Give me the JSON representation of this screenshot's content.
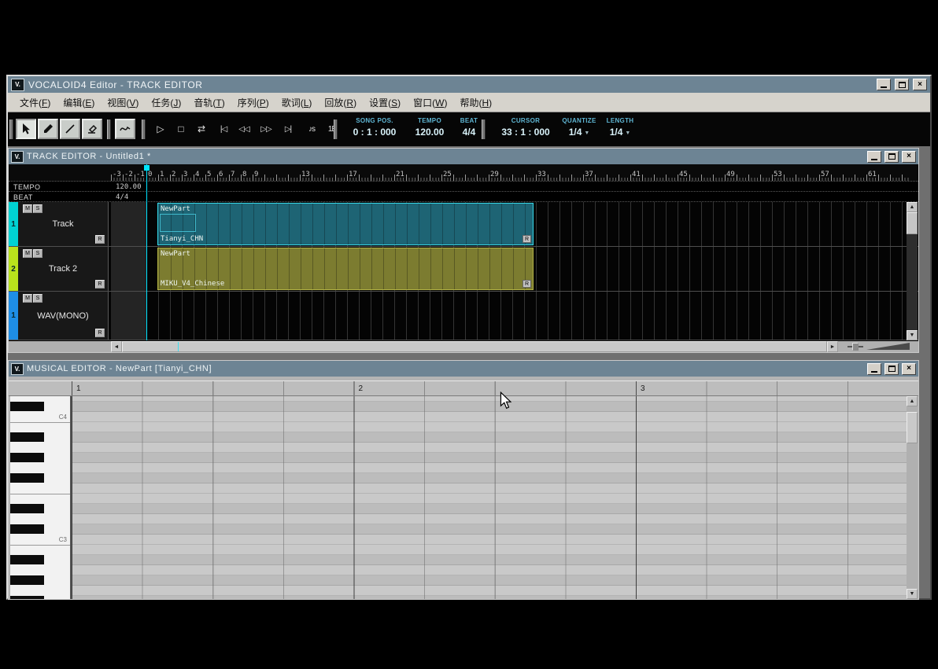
{
  "colors": {
    "titlebar": "#6d8494",
    "accent_cyan": "#00e4ff",
    "track1": "#00d2d2",
    "track2": "#b9e21c",
    "wav_track": "#1e8ee6",
    "part1_fill": "#1e6474",
    "part1_border": "#35d8e8",
    "part2_fill": "#7c7c30",
    "part2_border": "#b2b244",
    "display_label": "#5fb6d4",
    "display_value": "#d8f2fa"
  },
  "icons": {
    "app": "V.",
    "close": "×",
    "play": "▷",
    "stop": "□",
    "loop": "⇄",
    "to_start": "|◁",
    "rewind": "◁◁",
    "forward": "▷▷",
    "to_end": "▷|",
    "note_s": "♪s",
    "one_e": "1E",
    "dropdown": "▼",
    "arrow_left": "◄",
    "arrow_right": "►",
    "arrow_up": "▲",
    "arrow_down": "▼"
  },
  "app": {
    "title": "VOCALOID4 Editor - TRACK EDITOR"
  },
  "menu": {
    "items": [
      {
        "name": "文件",
        "key": "F"
      },
      {
        "name": "编辑",
        "key": "E"
      },
      {
        "name": "视图",
        "key": "V"
      },
      {
        "name": "任务",
        "key": "J"
      },
      {
        "name": "音轨",
        "key": "T"
      },
      {
        "name": "序列",
        "key": "P"
      },
      {
        "name": "歌词",
        "key": "L"
      },
      {
        "name": "回放",
        "key": "R"
      },
      {
        "name": "设置",
        "key": "S"
      },
      {
        "name": "窗口",
        "key": "W"
      },
      {
        "name": "帮助",
        "key": "H"
      }
    ]
  },
  "toolbar": {
    "song_pos": {
      "label": "SONG POS.",
      "value": "0 : 1 : 000"
    },
    "tempo": {
      "label": "TEMPO",
      "value": "120.00"
    },
    "beat": {
      "label": "BEAT",
      "value": "4/4"
    },
    "cursor": {
      "label": "CURSOR",
      "value": "33 : 1 : 000"
    },
    "quantize": {
      "label": "QUANTIZE",
      "value": "1/4"
    },
    "length": {
      "label": "LENGTH",
      "value": "1/4"
    }
  },
  "track_editor": {
    "title": "TRACK EDITOR - Untitled1 *",
    "tempo_label": "TEMPO",
    "tempo_value": "120.00",
    "beat_label": "BEAT",
    "beat_value": "4/4",
    "mute_label": "M",
    "solo_label": "S",
    "render_label": "R",
    "ruler": [
      {
        "label": "-3",
        "m": -3
      },
      {
        "label": "-2",
        "m": -2
      },
      {
        "label": "-1",
        "m": -1
      },
      {
        "label": "0",
        "m": 0
      },
      {
        "label": "1",
        "m": 1
      },
      {
        "label": "2",
        "m": 2
      },
      {
        "label": "3",
        "m": 3
      },
      {
        "label": "4",
        "m": 4
      },
      {
        "label": "5",
        "m": 5
      },
      {
        "label": "6",
        "m": 6
      },
      {
        "label": "7",
        "m": 7
      },
      {
        "label": "8",
        "m": 8
      },
      {
        "label": "9",
        "m": 9
      },
      {
        "label": "13",
        "m": 13
      },
      {
        "label": "17",
        "m": 17
      },
      {
        "label": "21",
        "m": 21
      },
      {
        "label": "25",
        "m": 25
      },
      {
        "label": "29",
        "m": 29
      },
      {
        "label": "33",
        "m": 33
      },
      {
        "label": "37",
        "m": 37
      },
      {
        "label": "41",
        "m": 41
      },
      {
        "label": "45",
        "m": 45
      },
      {
        "label": "49",
        "m": 49
      },
      {
        "label": "53",
        "m": 53
      },
      {
        "label": "57",
        "m": 57
      },
      {
        "label": "61",
        "m": 61
      }
    ],
    "tracks": [
      {
        "num": "1",
        "name": "Track",
        "part": {
          "name": "NewPart",
          "singer": "Tianyi_CHN"
        }
      },
      {
        "num": "2",
        "name": "Track 2",
        "part": {
          "name": "NewPart",
          "singer": "MIKU_V4_Chinese"
        }
      },
      {
        "num": "1",
        "name": "WAV(MONO)"
      }
    ]
  },
  "musical_editor": {
    "title": "MUSICAL EDITOR - NewPart [Tianyi_CHN]",
    "ruler": [
      "1",
      "2",
      "3"
    ],
    "key_labels": {
      "c4": "C4",
      "c3": "C3"
    }
  }
}
